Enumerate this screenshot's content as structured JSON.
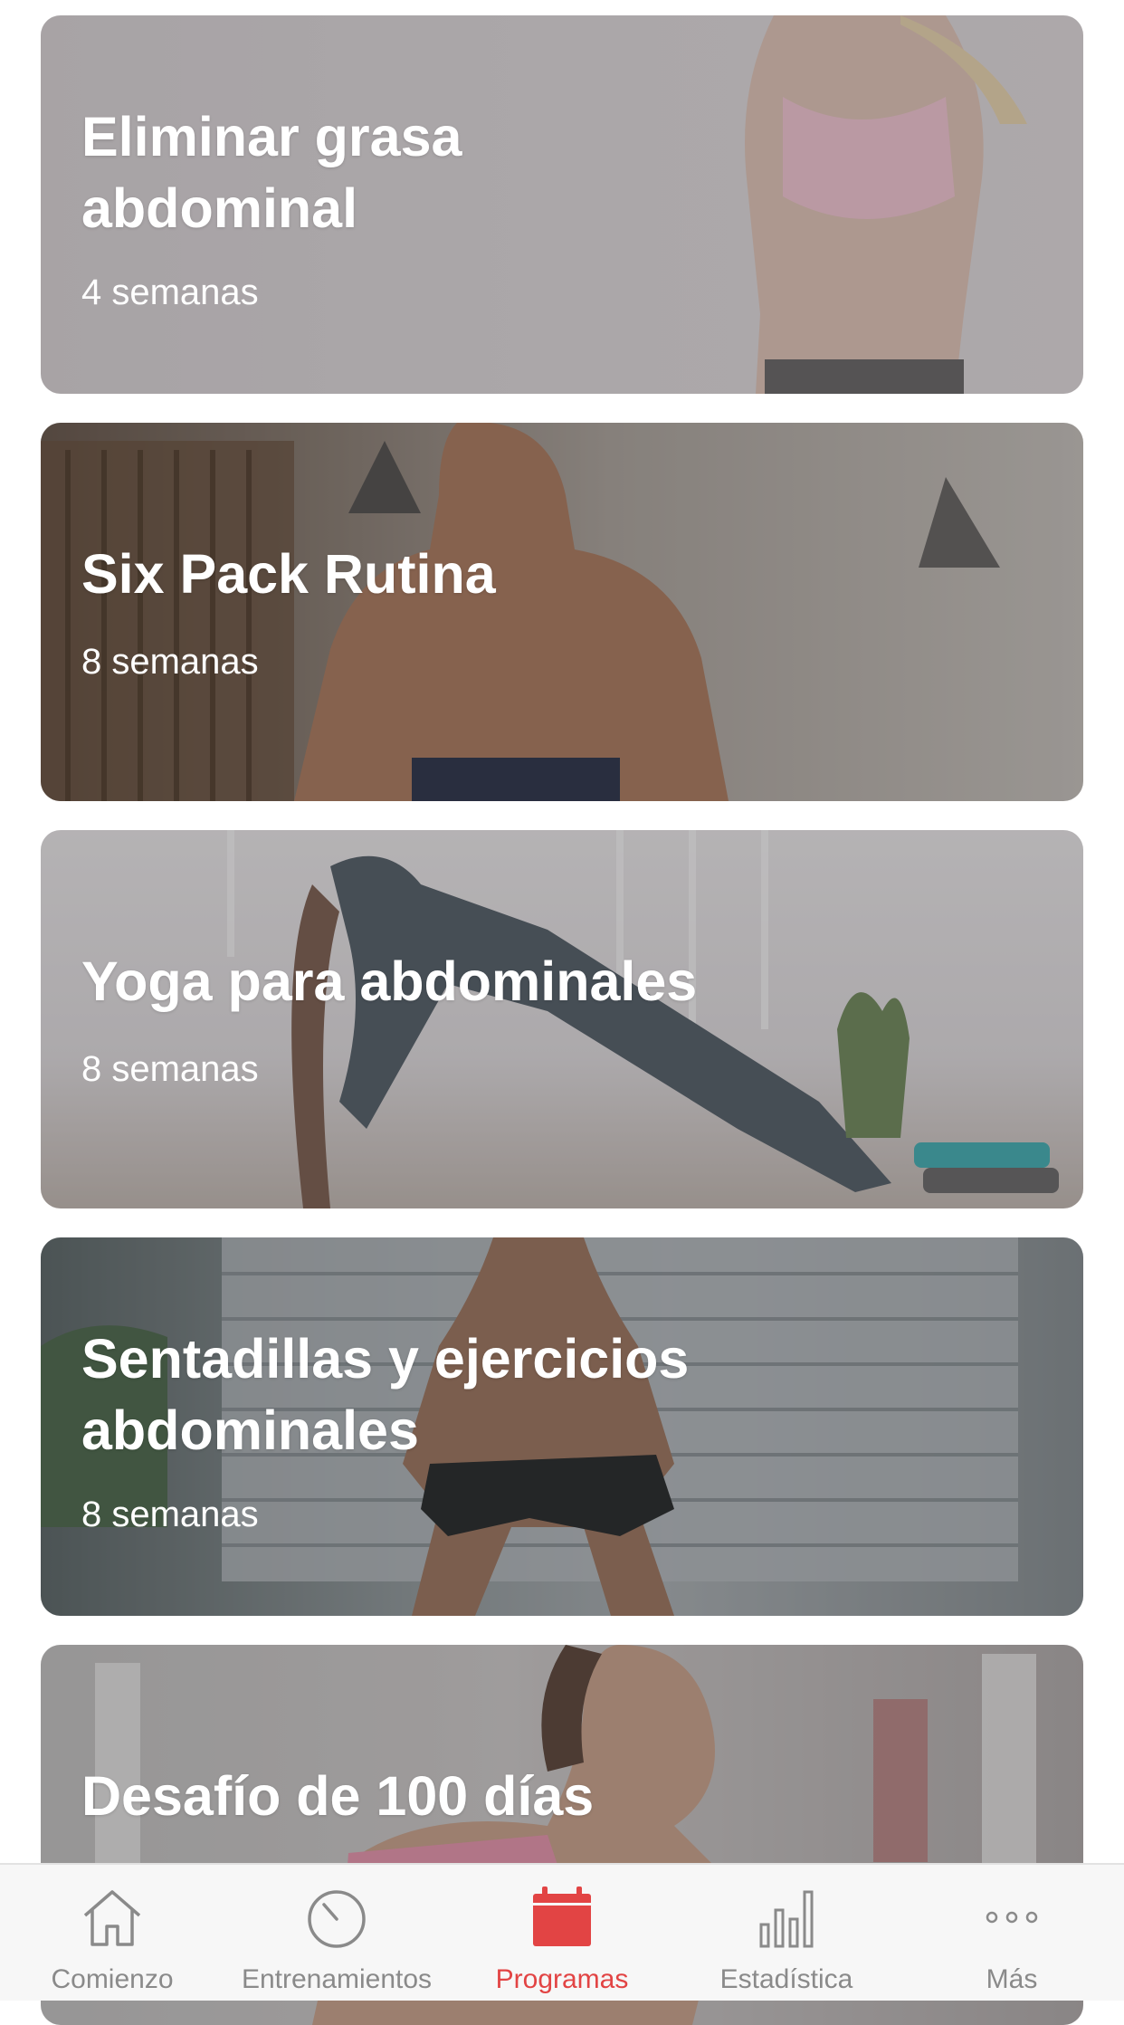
{
  "programs": [
    {
      "title_line1": "Eliminar grasa",
      "title_line2": "abdominal",
      "duration": "4 semanas"
    },
    {
      "title_line1": "Six Pack Rutina",
      "title_line2": "",
      "duration": "8 semanas"
    },
    {
      "title_line1": "Yoga para abdominales",
      "title_line2": "",
      "duration": "8 semanas"
    },
    {
      "title_line1": "Sentadillas y ejercicios",
      "title_line2": "abdominales",
      "duration": "8 semanas"
    },
    {
      "title_line1": "Desafío de 100 días",
      "title_line2": "",
      "duration": ""
    }
  ],
  "tabbar": {
    "items": [
      {
        "label": "Comienzo",
        "icon": "home-icon",
        "active": false
      },
      {
        "label": "Entrenamientos",
        "icon": "stopwatch-icon",
        "active": false
      },
      {
        "label": "Programas",
        "icon": "calendar-icon",
        "active": true
      },
      {
        "label": "Estadística",
        "icon": "bar-chart-icon",
        "active": false
      },
      {
        "label": "Más",
        "icon": "more-dots-icon",
        "active": false
      }
    ],
    "active_color": "#e24444",
    "inactive_color": "#8a8a8a"
  }
}
